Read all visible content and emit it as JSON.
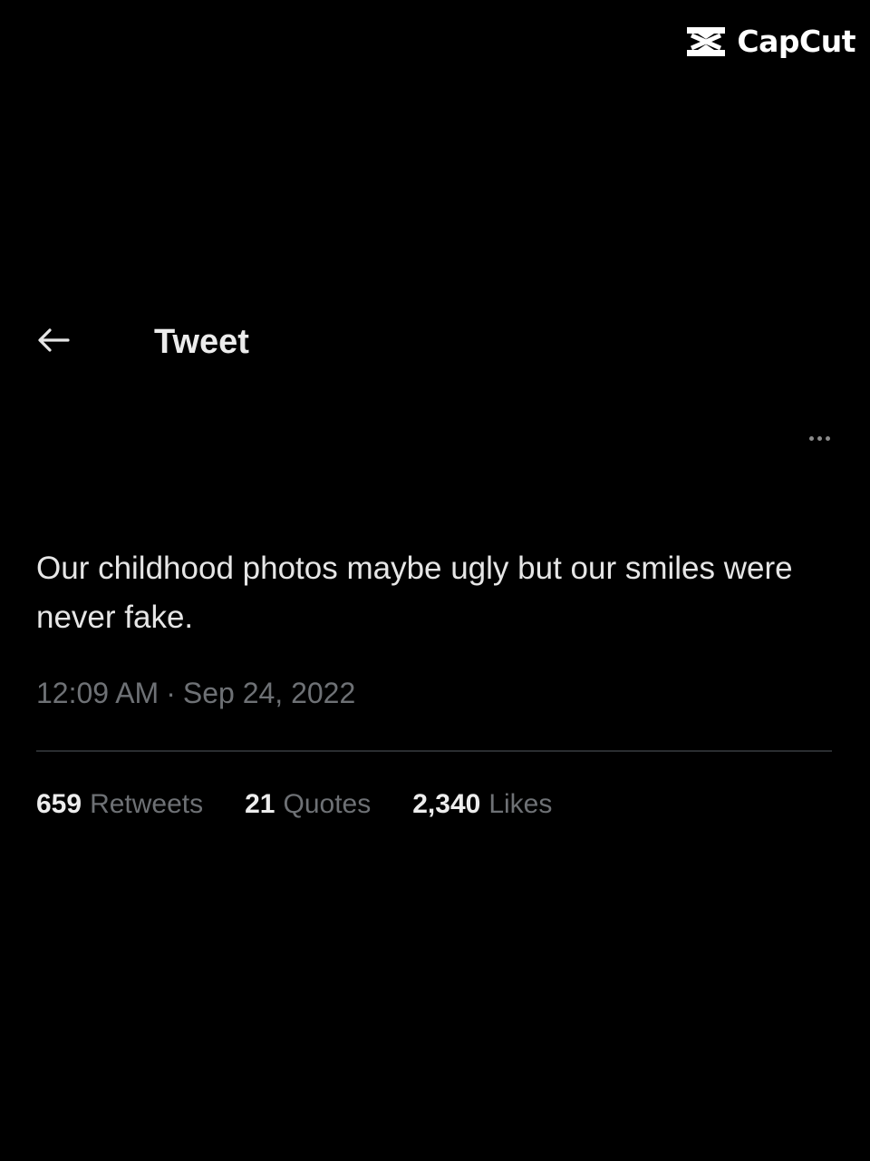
{
  "watermark": {
    "brand": "CapCut",
    "icon": "capcut-logo-icon"
  },
  "header": {
    "back_icon": "arrow-left-icon",
    "title": "Tweet"
  },
  "more_icon": "more-horizontal-icon",
  "tweet": {
    "text": "Our childhood photos maybe ugly but our smiles were never fake.",
    "time": "12:09 AM",
    "separator": "·",
    "date": "Sep 24, 2022"
  },
  "stats": [
    {
      "count": "659",
      "label": "Retweets"
    },
    {
      "count": "21",
      "label": "Quotes"
    },
    {
      "count": "2,340",
      "label": "Likes"
    }
  ],
  "colors": {
    "background": "#000000",
    "primary_text": "#e7e9ea",
    "secondary_text": "#6e7175",
    "divider": "#2a2d30"
  }
}
